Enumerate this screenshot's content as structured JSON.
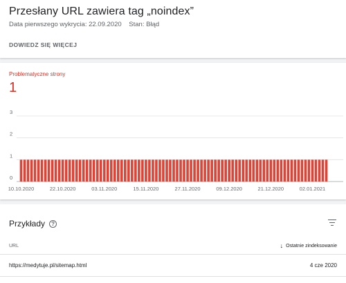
{
  "header": {
    "title": "Przesłany URL zawiera tag „noindex”",
    "first_detected": "Data pierwszego wykrycia: 22.09.2020",
    "status": "Stan: Błąd",
    "learn_more": "DOWIEDZ SIĘ WIĘCEJ"
  },
  "metric": {
    "label": "Problematyczne strony",
    "value": "1",
    "color": "#d93025"
  },
  "chart_data": {
    "type": "bar",
    "y_ticks": [
      "0",
      "1",
      "2",
      "3"
    ],
    "ylim": [
      0,
      3
    ],
    "x_tick_labels": [
      "10.10.2020",
      "22.10.2020",
      "03.11.2020",
      "15.11.2020",
      "27.11.2020",
      "09.12.2020",
      "21.12.2020",
      "02.01.2021"
    ],
    "x_tick_every_days": 12,
    "start_date": "2020-10-10",
    "days": 89,
    "values": [
      1,
      1,
      1,
      1,
      1,
      1,
      1,
      1,
      1,
      1,
      1,
      1,
      1,
      1,
      1,
      1,
      1,
      1,
      1,
      1,
      1,
      1,
      1,
      1,
      1,
      1,
      1,
      1,
      1,
      1,
      1,
      1,
      1,
      1,
      1,
      1,
      1,
      1,
      1,
      1,
      1,
      1,
      1,
      1,
      1,
      1,
      1,
      1,
      1,
      1,
      1,
      1,
      1,
      1,
      1,
      1,
      1,
      1,
      1,
      1,
      1,
      1,
      1,
      1,
      1,
      1,
      1,
      1,
      1,
      1,
      1,
      1,
      1,
      1,
      1,
      1,
      1,
      1,
      1,
      1,
      1,
      1,
      1,
      1,
      1,
      1,
      1,
      1,
      1
    ],
    "bar_color": "#db4437",
    "grid": true
  },
  "examples": {
    "title": "Przykłady",
    "help_icon": "help-circle-icon",
    "filter_icon": "filter-icon",
    "columns": {
      "url": "URL",
      "last_crawled": "Ostatnie zindeksowanie"
    },
    "sort_icon": "arrow-down-icon",
    "rows": [
      {
        "url": "https://medytuje.pl/sitemap.html",
        "date": "4 cze 2020"
      }
    ]
  }
}
